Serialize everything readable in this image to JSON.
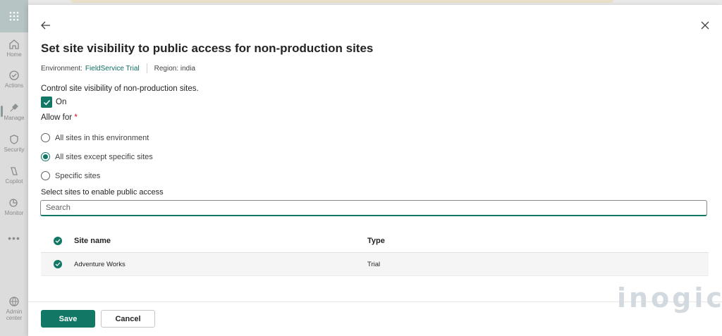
{
  "rail": {
    "items": [
      {
        "label": "Home",
        "icon": "home-icon"
      },
      {
        "label": "Actions",
        "icon": "actions-icon"
      },
      {
        "label": "Manage",
        "icon": "manage-icon"
      },
      {
        "label": "Security",
        "icon": "shield-icon"
      },
      {
        "label": "Copilot",
        "icon": "copilot-icon"
      },
      {
        "label": "Monitor",
        "icon": "monitor-icon"
      },
      {
        "label": "Admin center",
        "icon": "admin-center-icon"
      }
    ]
  },
  "panel": {
    "title": "Set site visibility to public access for non-production sites",
    "environment_label": "Environment:",
    "environment_value": "FieldService Trial",
    "region": "Region: india",
    "control_label": "Control site visibility of non-production sites.",
    "toggle_label": "On",
    "allow_label": "Allow for",
    "required_mark": "*",
    "options": [
      {
        "label": "All sites in this environment",
        "checked": false
      },
      {
        "label": "All sites except specific sites",
        "checked": true
      },
      {
        "label": "Specific sites",
        "checked": false
      }
    ],
    "select_label": "Select sites to enable public access",
    "search_placeholder": "Search",
    "table": {
      "headers": [
        "Site name",
        "Type"
      ],
      "rows": [
        {
          "name": "Adventure Works",
          "type": "Trial"
        }
      ]
    },
    "save_label": "Save",
    "cancel_label": "Cancel"
  },
  "watermark": "inogic",
  "colors": {
    "accent": "#117865",
    "link": "#0f6e62",
    "required": "#c50f1f"
  }
}
